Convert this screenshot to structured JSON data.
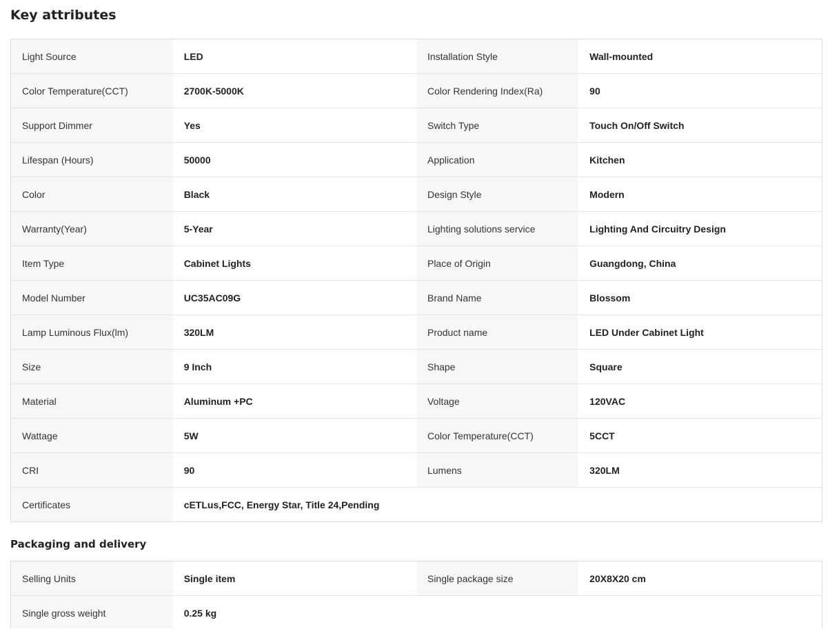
{
  "key_attributes": {
    "title": "Key attributes",
    "rows": [
      [
        {
          "label": "Light Source",
          "value": "LED"
        },
        {
          "label": "Installation Style",
          "value": "Wall-mounted"
        }
      ],
      [
        {
          "label": "Color Temperature(CCT)",
          "value": "2700K-5000K"
        },
        {
          "label": "Color Rendering Index(Ra)",
          "value": "90"
        }
      ],
      [
        {
          "label": "Support Dimmer",
          "value": "Yes"
        },
        {
          "label": "Switch Type",
          "value": "Touch On/Off Switch"
        }
      ],
      [
        {
          "label": "Lifespan (Hours)",
          "value": "50000"
        },
        {
          "label": "Application",
          "value": "Kitchen"
        }
      ],
      [
        {
          "label": "Color",
          "value": "Black"
        },
        {
          "label": "Design Style",
          "value": "Modern"
        }
      ],
      [
        {
          "label": "Warranty(Year)",
          "value": "5-Year"
        },
        {
          "label": "Lighting solutions service",
          "value": "Lighting And Circuitry Design"
        }
      ],
      [
        {
          "label": "Item Type",
          "value": "Cabinet Lights"
        },
        {
          "label": "Place of Origin",
          "value": "Guangdong, China"
        }
      ],
      [
        {
          "label": "Model Number",
          "value": "UC35AC09G"
        },
        {
          "label": "Brand Name",
          "value": "Blossom"
        }
      ],
      [
        {
          "label": "Lamp Luminous Flux(lm)",
          "value": "320LM"
        },
        {
          "label": "Product name",
          "value": "LED Under Cabinet Light"
        }
      ],
      [
        {
          "label": "Size",
          "value": "9 Inch"
        },
        {
          "label": "Shape",
          "value": "Square"
        }
      ],
      [
        {
          "label": "Material",
          "value": "Aluminum +PC"
        },
        {
          "label": "Voltage",
          "value": "120VAC"
        }
      ],
      [
        {
          "label": "Wattage",
          "value": "5W"
        },
        {
          "label": "Color Temperature(CCT)",
          "value": "5CCT"
        }
      ],
      [
        {
          "label": "CRI",
          "value": "90"
        },
        {
          "label": "Lumens",
          "value": "320LM"
        }
      ],
      [
        {
          "label": "Certificates",
          "value": "cETLus,FCC, Energy Star, Title 24,Pending"
        }
      ]
    ]
  },
  "packaging": {
    "title": "Packaging and delivery",
    "rows": [
      [
        {
          "label": "Selling Units",
          "value": "Single item"
        },
        {
          "label": "Single package size",
          "value": "20X8X20 cm"
        }
      ],
      [
        {
          "label": "Single gross weight",
          "value": "0.25 kg"
        }
      ]
    ]
  }
}
